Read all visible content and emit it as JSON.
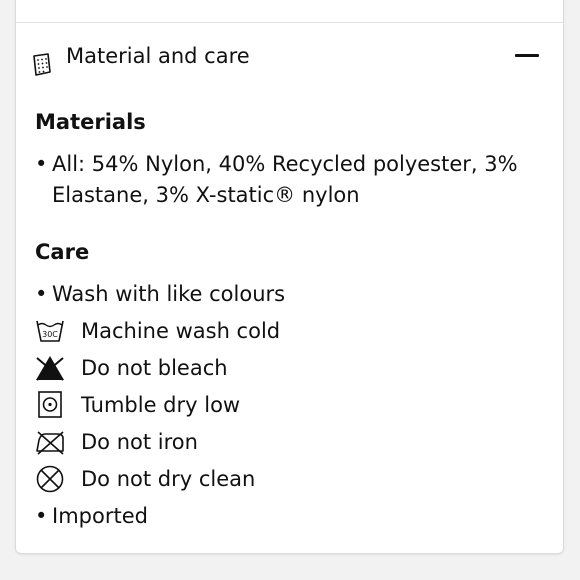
{
  "section": {
    "title": "Material and care",
    "icon": "care-label-icon",
    "toggle_icon": "minus-icon"
  },
  "materials": {
    "heading": "Materials",
    "items": [
      "All: 54% Nylon, 40% Recycled polyester, 3% Elastane, 3% X-static® nylon"
    ]
  },
  "care": {
    "heading": "Care",
    "wash_note": "Wash with like colours",
    "wash_icon_label": "30C",
    "instructions": [
      {
        "icon": "machine-wash-cold-icon",
        "text": "Machine wash cold"
      },
      {
        "icon": "do-not-bleach-icon",
        "text": "Do not bleach"
      },
      {
        "icon": "tumble-dry-low-icon",
        "text": "Tumble dry low"
      },
      {
        "icon": "do-not-iron-icon",
        "text": "Do not iron"
      },
      {
        "icon": "do-not-dry-clean-icon",
        "text": "Do not dry clean"
      }
    ],
    "footer_note": "Imported"
  }
}
